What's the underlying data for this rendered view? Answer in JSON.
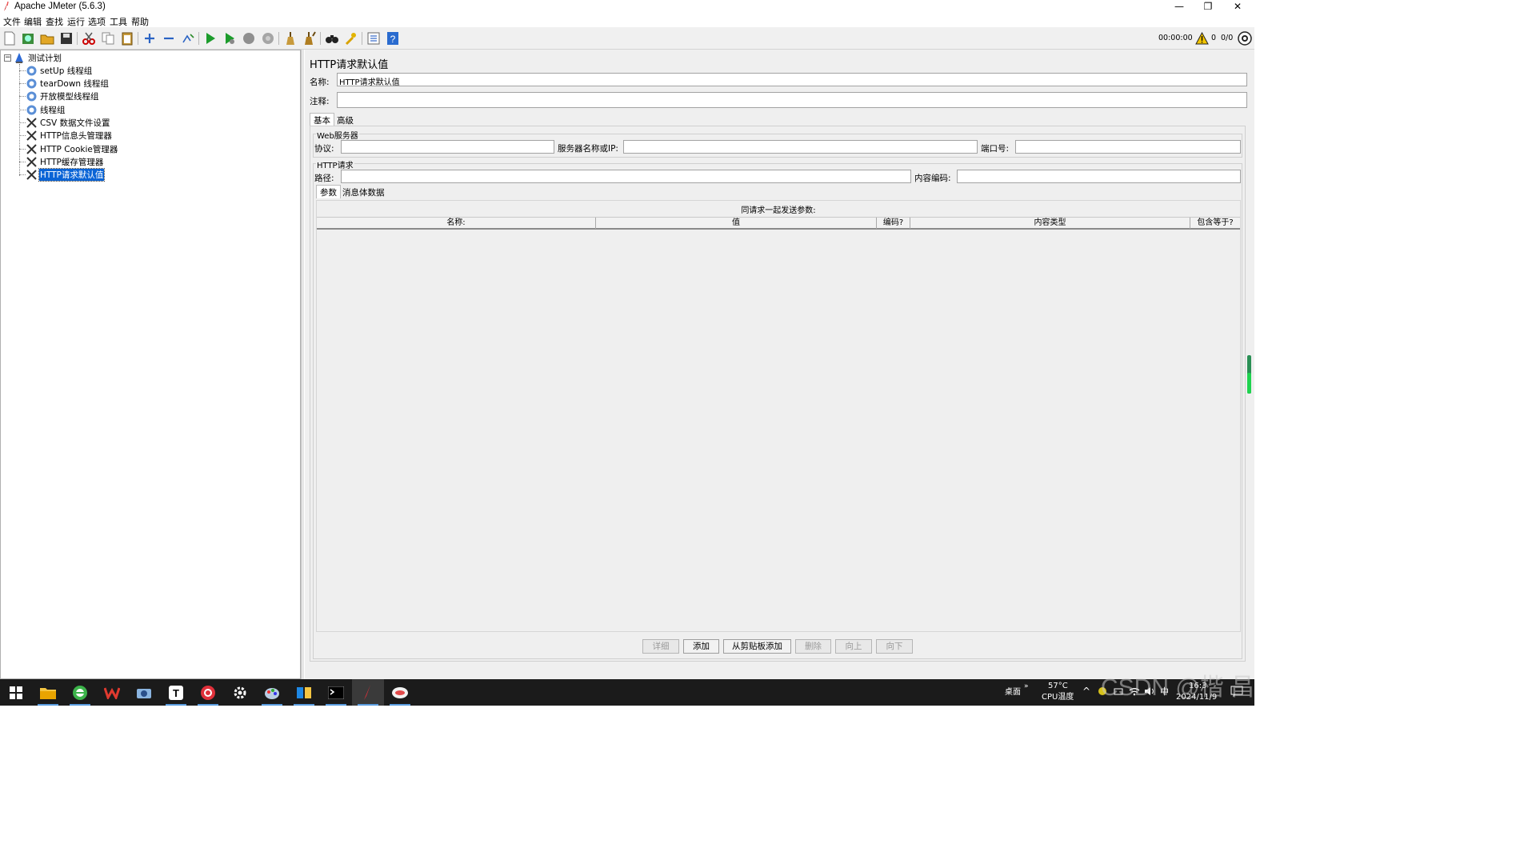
{
  "window": {
    "title": "Apache JMeter (5.6.3)",
    "controls": {
      "minimize": "—",
      "restore": "❐",
      "close": "✕"
    }
  },
  "menu": [
    "文件",
    "编辑",
    "查找",
    "运行",
    "选项",
    "工具",
    "帮助"
  ],
  "toolbar": {
    "timer": "00:00:00",
    "warning_count": "0",
    "thread_count": "0/0",
    "icons": [
      "new-icon",
      "templates-icon",
      "open-icon",
      "save-icon",
      "cut-icon",
      "copy-icon",
      "paste-icon",
      "expand-icon",
      "collapse-icon",
      "toggle-icon",
      "start-icon",
      "start-no-pause-icon",
      "stop-icon",
      "shutdown-icon",
      "clear-icon",
      "clear-all-icon",
      "search-icon",
      "reset-search-icon",
      "function-helper-icon",
      "help-icon"
    ]
  },
  "tree": {
    "root": "测试计划",
    "items": [
      {
        "label": "setUp 线程组",
        "icon": "thread-group-icon"
      },
      {
        "label": "tearDown 线程组",
        "icon": "thread-group-icon"
      },
      {
        "label": "开放模型线程组",
        "icon": "thread-group-icon"
      },
      {
        "label": "线程组",
        "icon": "thread-group-icon"
      },
      {
        "label": "CSV 数据文件设置",
        "icon": "config-element-icon"
      },
      {
        "label": "HTTP信息头管理器",
        "icon": "config-element-icon"
      },
      {
        "label": "HTTP Cookie管理器",
        "icon": "config-element-icon"
      },
      {
        "label": "HTTP缓存管理器",
        "icon": "config-element-icon"
      },
      {
        "label": "HTTP请求默认值",
        "icon": "config-element-icon",
        "selected": true
      }
    ]
  },
  "panel": {
    "title": "HTTP请求默认值",
    "name_label": "名称:",
    "name_value": "HTTP请求默认值",
    "comment_label": "注释:",
    "comment_value": "",
    "tabs": [
      "基本",
      "高级"
    ],
    "web_server": {
      "group_label": "Web服务器",
      "protocol_label": "协议:",
      "protocol_value": "",
      "server_label": "服务器名称或IP:",
      "server_value": "",
      "port_label": "端口号:",
      "port_value": ""
    },
    "http_request": {
      "group_label": "HTTP请求",
      "path_label": "路径:",
      "path_value": "",
      "encoding_label": "内容编码:",
      "encoding_value": ""
    },
    "subtabs": [
      "参数",
      "消息体数据"
    ],
    "params_caption": "同请求一起发送参数:",
    "columns": [
      "名称:",
      "值",
      "编码?",
      "内容类型",
      "包含等于?"
    ],
    "buttons": [
      {
        "label": "详细",
        "enabled": false
      },
      {
        "label": "添加",
        "enabled": true
      },
      {
        "label": "从剪贴板添加",
        "enabled": true
      },
      {
        "label": "删除",
        "enabled": false
      },
      {
        "label": "向上",
        "enabled": false
      },
      {
        "label": "向下",
        "enabled": false
      }
    ]
  },
  "taskbar": {
    "apps": [
      "windows-start-icon",
      "file-explorer-icon",
      "browser-icon",
      "wps-icon",
      "camera-icon",
      "typora-icon",
      "netease-music-icon",
      "settings-icon",
      "paint-icon",
      "folder-icon",
      "terminal-icon",
      "jmeter-icon",
      "chat-icon"
    ],
    "desktop_label": "桌面",
    "temp": "57°C",
    "temp_label": "CPU温度",
    "ime": "中",
    "time": "16:3",
    "date": "2024/11/9"
  },
  "watermark": "CSDN @楷 昌"
}
